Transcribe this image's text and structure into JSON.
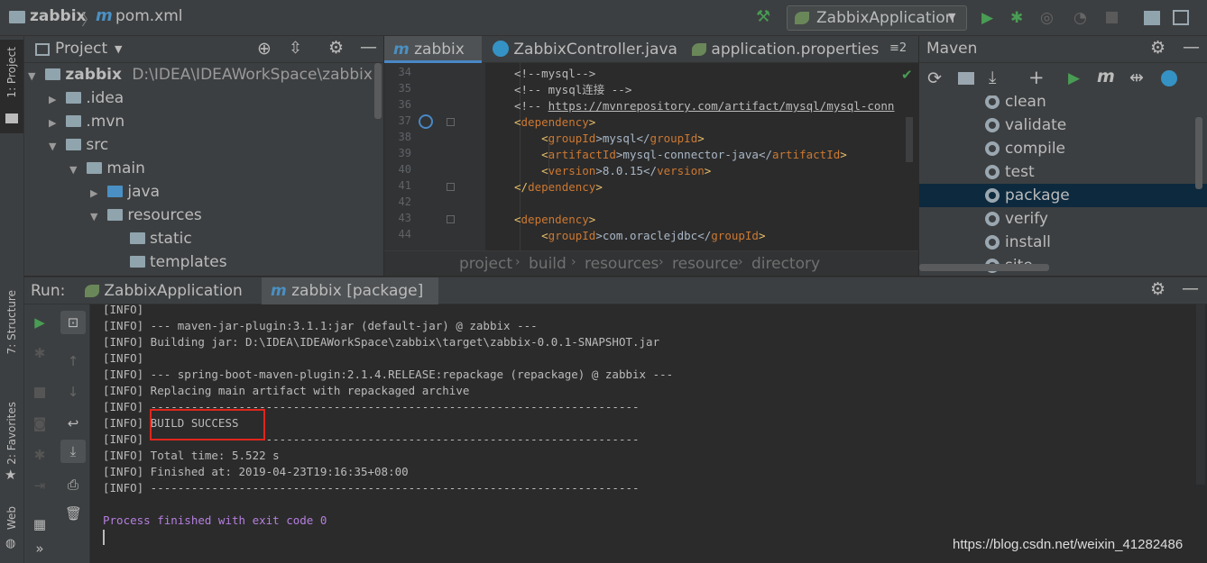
{
  "breadcrumb": {
    "project": "zabbix",
    "file": "pom.xml"
  },
  "run_config": {
    "label": "ZabbixApplication"
  },
  "left_strip": {
    "project": "1: Project",
    "structure": "7: Structure",
    "favorites": "2: Favorites",
    "web": "Web"
  },
  "project_panel": {
    "title": "Project",
    "tree": [
      {
        "label": "zabbix",
        "path": "D:\\IDEA\\IDEAWorkSpace\\zabbix"
      },
      {
        "label": ".idea"
      },
      {
        "label": ".mvn"
      },
      {
        "label": "src"
      },
      {
        "label": "main"
      },
      {
        "label": "java"
      },
      {
        "label": "resources"
      },
      {
        "label": "static"
      },
      {
        "label": "templates"
      }
    ]
  },
  "editor": {
    "tabs": [
      {
        "label": "zabbix"
      },
      {
        "label": "ZabbixController.java"
      },
      {
        "label": "application.properties"
      }
    ],
    "tab_overflow": "≡2",
    "line_numbers": [
      "34",
      "35",
      "36",
      "37",
      "38",
      "39",
      "40",
      "41",
      "42",
      "43",
      "44"
    ],
    "lines": [
      {
        "t1": "<!--mysql-->"
      },
      {
        "t1": "<!-- mysql连接 -->"
      },
      {
        "t1": "<!-- ",
        "t2": "https://mvnrepository.com/artifact/mysql/mysql-conn"
      },
      {
        "t1": "<",
        "t2": "dependency",
        "t3": ">"
      },
      {
        "t1": "    <",
        "t2": "groupId",
        "t3": ">mysql</",
        "t4": "groupId",
        "t5": ">"
      },
      {
        "t1": "    <",
        "t2": "artifactId",
        "t3": ">mysql-connector-java</",
        "t4": "artifactId",
        "t5": ">"
      },
      {
        "t1": "    <",
        "t2": "version",
        "t3": ">8.0.15</",
        "t4": "version",
        "t5": ">"
      },
      {
        "t1": "</",
        "t2": "dependency",
        "t3": ">"
      },
      {
        "t1": ""
      },
      {
        "t1": "<",
        "t2": "dependency",
        "t3": ">"
      },
      {
        "t1": "    <",
        "t2": "groupId",
        "t3": ">com.oraclejdbc</",
        "t4": "groupId",
        "t5": ">"
      }
    ],
    "crumbs": [
      "project",
      "build",
      "resources",
      "resource",
      "directory"
    ]
  },
  "maven": {
    "title": "Maven",
    "lifecycle": [
      "clean",
      "validate",
      "compile",
      "test",
      "package",
      "verify",
      "install",
      "site"
    ],
    "selected": "package"
  },
  "run_panel": {
    "label": "Run:",
    "tabs": [
      {
        "label": "ZabbixApplication"
      },
      {
        "label": "zabbix [package]"
      }
    ],
    "console": [
      "[INFO]",
      "[INFO] --- maven-jar-plugin:3.1.1:jar (default-jar) @ zabbix ---",
      "[INFO] Building jar: D:\\IDEA\\IDEAWorkSpace\\zabbix\\target\\zabbix-0.0.1-SNAPSHOT.jar",
      "[INFO]",
      "[INFO] --- spring-boot-maven-plugin:2.1.4.RELEASE:repackage (repackage) @ zabbix ---",
      "[INFO] Replacing main artifact with repackaged archive",
      "[INFO] ------------------------------------------------------------------------",
      "[INFO] BUILD SUCCESS",
      "[INFO] ------------------------------------------------------------------------",
      "[INFO] Total time: 5.522 s",
      "[INFO] Finished at: 2019-04-23T19:16:35+08:00",
      "[INFO] ------------------------------------------------------------------------",
      "",
      "Process finished with exit code 0"
    ]
  },
  "watermark": "https://blog.csdn.net/weixin_41282486",
  "colors": {
    "accent": "#4a88c7",
    "highlight_box": "#e0261c",
    "process_text": "#b57fdf",
    "run_green": "#499c54"
  }
}
